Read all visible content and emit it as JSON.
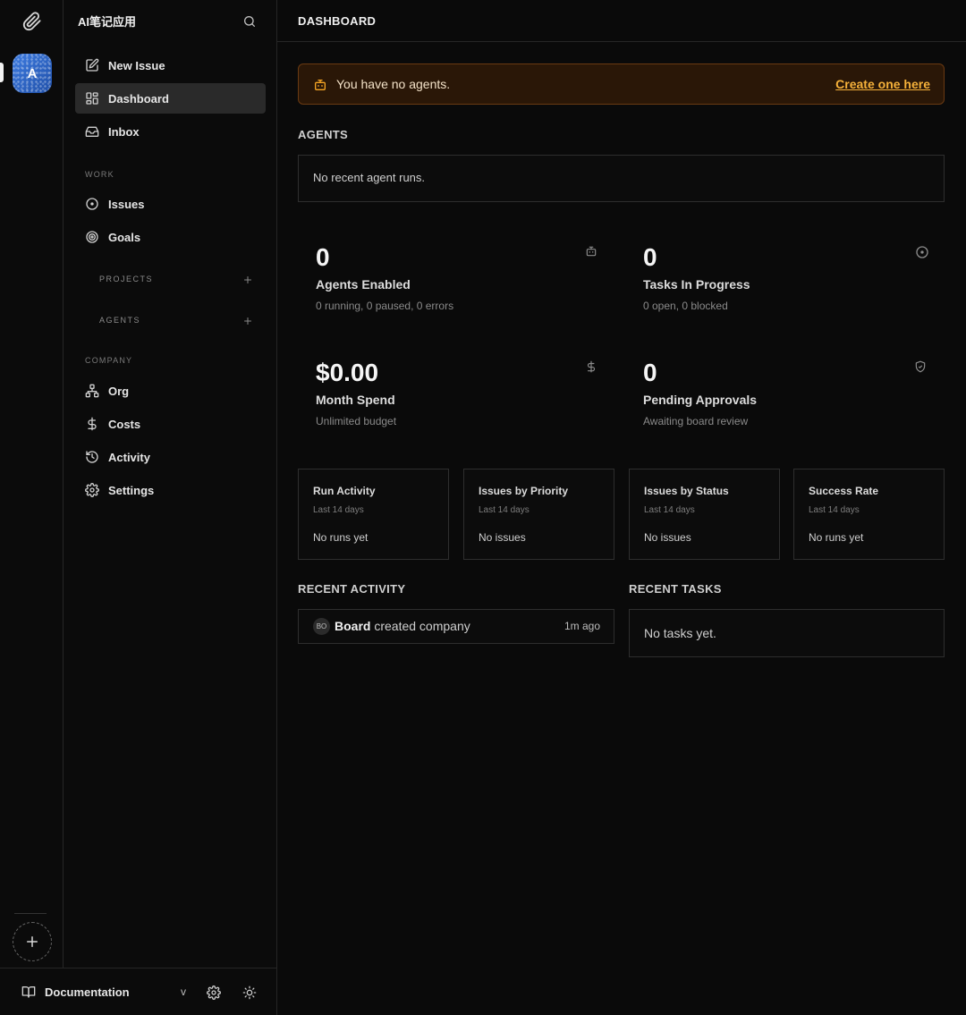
{
  "rail": {
    "company_initial": "A"
  },
  "sidebar": {
    "company_name": "AI笔记应用",
    "top_items": [
      {
        "label": "New Issue"
      },
      {
        "label": "Dashboard"
      },
      {
        "label": "Inbox"
      }
    ],
    "work_label": "WORK",
    "work_items": [
      {
        "label": "Issues"
      },
      {
        "label": "Goals"
      }
    ],
    "projects_label": "PROJECTS",
    "agents_label": "AGENTS",
    "company_label": "COMPANY",
    "company_items": [
      {
        "label": "Org"
      },
      {
        "label": "Costs"
      },
      {
        "label": "Activity"
      },
      {
        "label": "Settings"
      }
    ]
  },
  "footer": {
    "docs_label": "Documentation",
    "version": "v"
  },
  "header": {
    "title": "DASHBOARD"
  },
  "alert": {
    "text": "You have no agents.",
    "link": "Create one here",
    "color": "#f5a524"
  },
  "agents_section": {
    "title": "AGENTS",
    "empty": "No recent agent runs."
  },
  "metrics": [
    {
      "value": "0",
      "label": "Agents Enabled",
      "sub": "0 running, 0 paused, 0 errors",
      "icon": "bot-icon"
    },
    {
      "value": "0",
      "label": "Tasks In Progress",
      "sub": "0 open, 0 blocked",
      "icon": "circle-dot-icon"
    },
    {
      "value": "$0.00",
      "label": "Month Spend",
      "sub": "Unlimited budget",
      "icon": "dollar-icon"
    },
    {
      "value": "0",
      "label": "Pending Approvals",
      "sub": "Awaiting board review",
      "icon": "shield-check-icon"
    }
  ],
  "cards": [
    {
      "title": "Run Activity",
      "subtitle": "Last 14 days",
      "empty": "No runs yet"
    },
    {
      "title": "Issues by Priority",
      "subtitle": "Last 14 days",
      "empty": "No issues"
    },
    {
      "title": "Issues by Status",
      "subtitle": "Last 14 days",
      "empty": "No issues"
    },
    {
      "title": "Success Rate",
      "subtitle": "Last 14 days",
      "empty": "No runs yet"
    }
  ],
  "recent_activity": {
    "title": "RECENT ACTIVITY",
    "items": [
      {
        "badge": "BO",
        "actor": "Board",
        "action": "created company",
        "time": "1m ago"
      }
    ]
  },
  "recent_tasks": {
    "title": "RECENT TASKS",
    "empty": "No tasks yet."
  }
}
